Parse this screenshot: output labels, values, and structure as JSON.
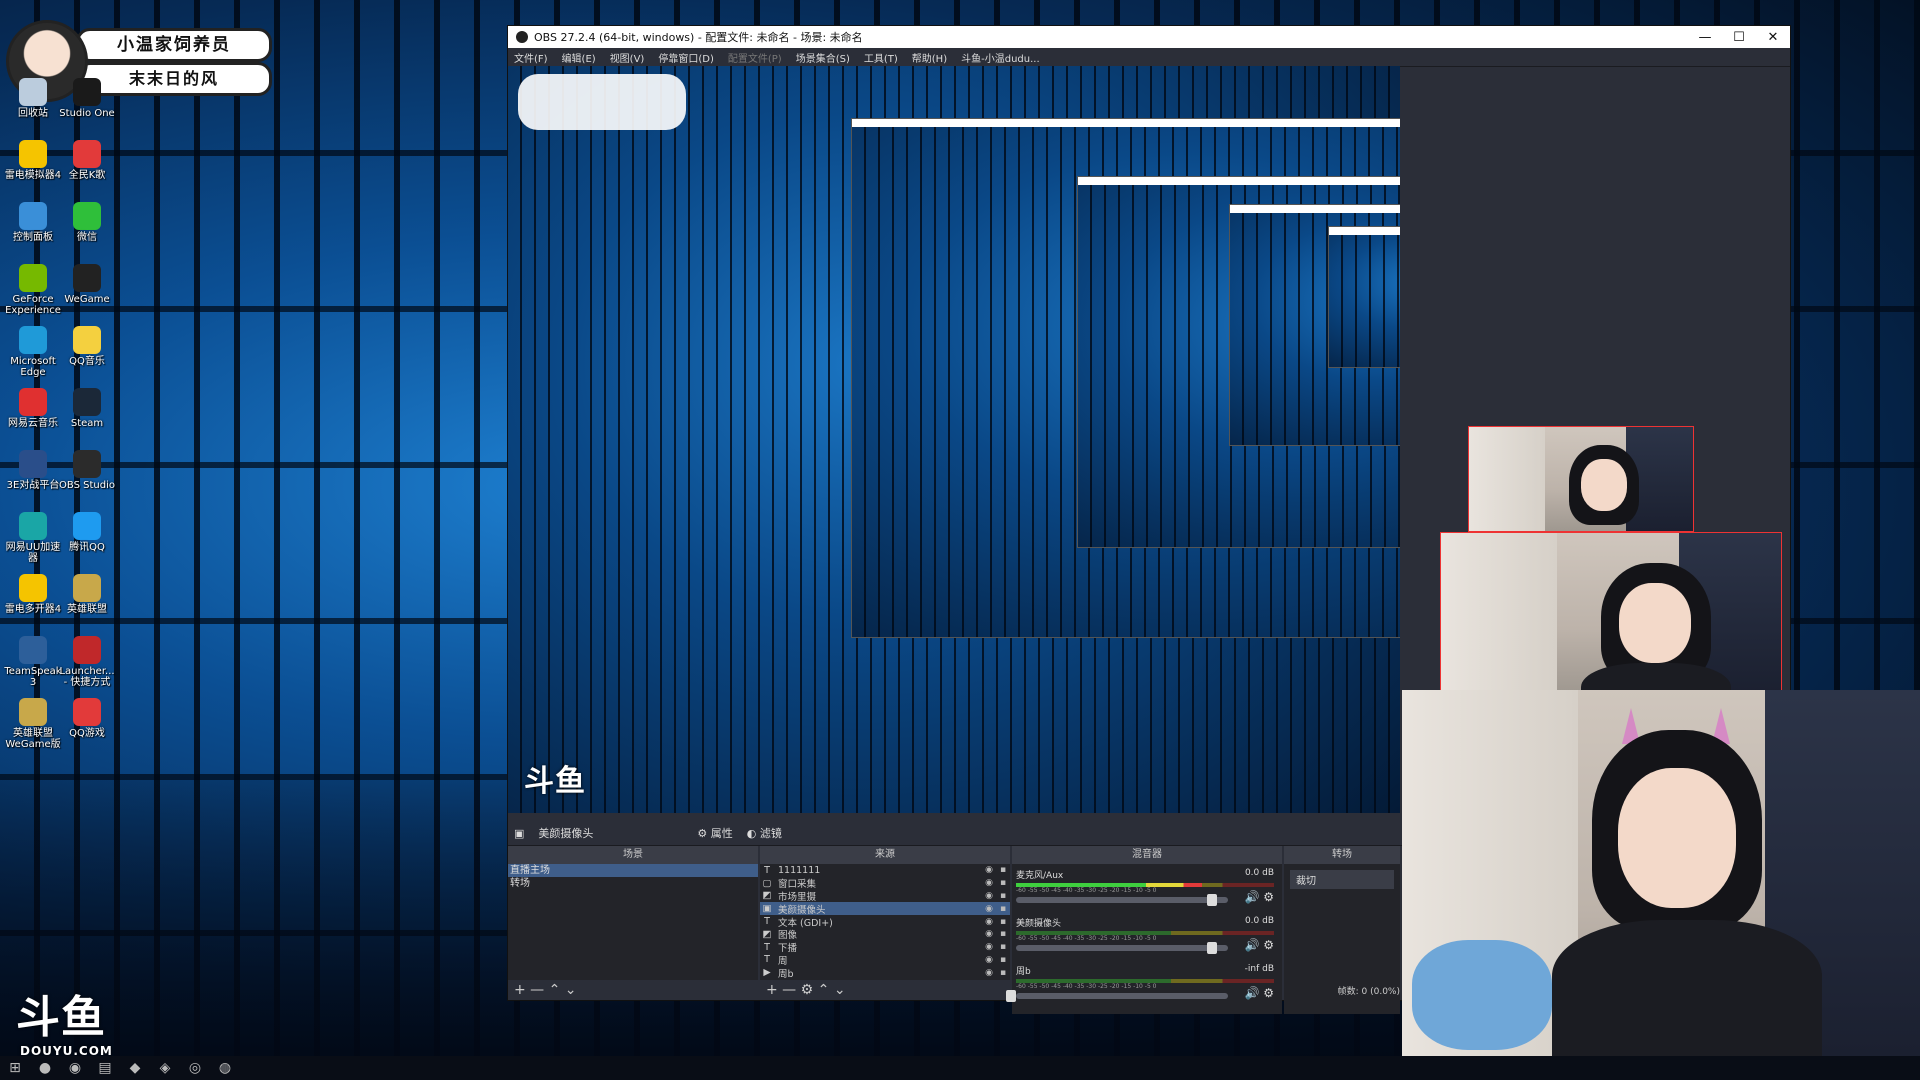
{
  "banner": {
    "line1": "小温家饲养员",
    "line2": "末末日的风"
  },
  "desktop_icons": [
    {
      "label": "回收站",
      "color": "#bcd"
    },
    {
      "label": "Studio One",
      "color": "#1a1a1a"
    },
    {
      "label": "雷电模拟器4",
      "color": "#f5c400"
    },
    {
      "label": "全民K歌",
      "color": "#e23a3a"
    },
    {
      "label": "控制面板",
      "color": "#3a8fd8"
    },
    {
      "label": "微信",
      "color": "#2fbf3a"
    },
    {
      "label": "GeForce Experience",
      "color": "#76b900"
    },
    {
      "label": "WeGame",
      "color": "#222"
    },
    {
      "label": "Microsoft Edge",
      "color": "#1f9ad8"
    },
    {
      "label": "QQ音乐",
      "color": "#f4d03f"
    },
    {
      "label": "网易云音乐",
      "color": "#e03030"
    },
    {
      "label": "Steam",
      "color": "#1b2838"
    },
    {
      "label": "3E对战平台",
      "color": "#2a4e8a"
    },
    {
      "label": "OBS Studio",
      "color": "#2b2b2b"
    },
    {
      "label": "网易UU加速器",
      "color": "#1aa6a6"
    },
    {
      "label": "腾讯QQ",
      "color": "#1e9bf0"
    },
    {
      "label": "雷电多开器4",
      "color": "#f5c400"
    },
    {
      "label": "英雄联盟",
      "color": "#c8a84a"
    },
    {
      "label": "TeamSpeak 3",
      "color": "#2d5f9a"
    },
    {
      "label": "Launcher... - 快捷方式",
      "color": "#c0282a"
    },
    {
      "label": "英雄联盟WeGame版",
      "color": "#c8a84a"
    },
    {
      "label": "QQ游戏",
      "color": "#e23a3a"
    }
  ],
  "obs": {
    "title": "OBS 27.2.4 (64-bit, windows) - 配置文件: 未命名 - 场景: 未命名",
    "menu": [
      "文件(F)",
      "编辑(E)",
      "视图(V)",
      "停靠窗口(D)",
      "配置文件(P)",
      "场景集合(S)",
      "工具(T)",
      "帮助(H)",
      "斗鱼-小温dudu..."
    ],
    "menu_disabled_index": 4,
    "window_controls": [
      "—",
      "☐",
      "✕"
    ],
    "current_scene": "美颜摄像头",
    "scene_buttons": [
      "⚙ 属性",
      "◐ 滤镜"
    ],
    "docks": {
      "scenes": "场景",
      "sources": "来源",
      "mixer": "混音器",
      "transitions": "转场"
    },
    "scenes": [
      "直播主场",
      "转场"
    ],
    "selected_scene_index": 0,
    "sources": [
      {
        "icon": "T",
        "name": "1111111"
      },
      {
        "icon": "▢",
        "name": "窗口采集"
      },
      {
        "icon": "◩",
        "name": "市场里摄"
      },
      {
        "icon": "▣",
        "name": "美颜摄像头"
      },
      {
        "icon": "T",
        "name": "文本 (GDI+)"
      },
      {
        "icon": "◩",
        "name": "图像"
      },
      {
        "icon": "T",
        "name": "下播"
      },
      {
        "icon": "T",
        "name": "周"
      },
      {
        "icon": "▶",
        "name": "周b"
      }
    ],
    "selected_source_index": 3,
    "mixer": [
      {
        "name": "麦克风/Aux",
        "db": "0.0 dB",
        "level": 0.72,
        "fader": 0.95
      },
      {
        "name": "美颜摄像头",
        "db": "0.0 dB",
        "level": 0.0,
        "fader": 0.95
      },
      {
        "name": "周b",
        "db": "-inf dB",
        "level": 0.0,
        "fader": 0.0
      }
    ],
    "mixer_scale": "-60 -55 -50 -45 -40 -35 -30 -25 -20 -15 -10 -5 0",
    "transition": "裁切",
    "status": "帧数: 0 (0.0%)",
    "list_buttons": "+ — ⌃ ⌄",
    "source_buttons": "+ — ⚙ ⌃ ⌄"
  },
  "watermark": {
    "logo": "斗鱼",
    "url": "DOUYU.COM"
  },
  "taskbar_icons": [
    "⊞",
    "●",
    "◉",
    "▤",
    "◆",
    "◈",
    "◎",
    "◍"
  ]
}
